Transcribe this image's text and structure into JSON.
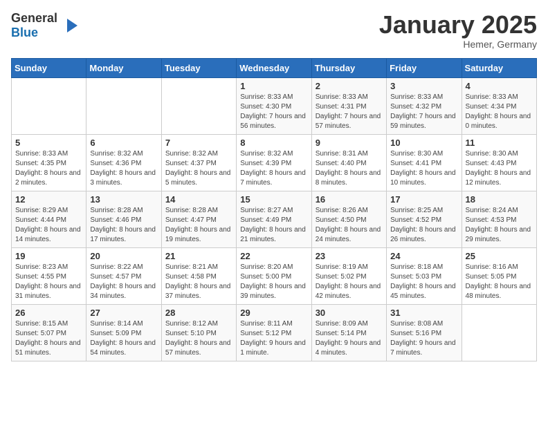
{
  "header": {
    "logo_general": "General",
    "logo_blue": "Blue",
    "title": "January 2025",
    "subtitle": "Hemer, Germany"
  },
  "weekdays": [
    "Sunday",
    "Monday",
    "Tuesday",
    "Wednesday",
    "Thursday",
    "Friday",
    "Saturday"
  ],
  "weeks": [
    [
      {
        "day": "",
        "sunrise": "",
        "sunset": "",
        "daylight": ""
      },
      {
        "day": "",
        "sunrise": "",
        "sunset": "",
        "daylight": ""
      },
      {
        "day": "",
        "sunrise": "",
        "sunset": "",
        "daylight": ""
      },
      {
        "day": "1",
        "sunrise": "Sunrise: 8:33 AM",
        "sunset": "Sunset: 4:30 PM",
        "daylight": "Daylight: 7 hours and 56 minutes."
      },
      {
        "day": "2",
        "sunrise": "Sunrise: 8:33 AM",
        "sunset": "Sunset: 4:31 PM",
        "daylight": "Daylight: 7 hours and 57 minutes."
      },
      {
        "day": "3",
        "sunrise": "Sunrise: 8:33 AM",
        "sunset": "Sunset: 4:32 PM",
        "daylight": "Daylight: 7 hours and 59 minutes."
      },
      {
        "day": "4",
        "sunrise": "Sunrise: 8:33 AM",
        "sunset": "Sunset: 4:34 PM",
        "daylight": "Daylight: 8 hours and 0 minutes."
      }
    ],
    [
      {
        "day": "5",
        "sunrise": "Sunrise: 8:33 AM",
        "sunset": "Sunset: 4:35 PM",
        "daylight": "Daylight: 8 hours and 2 minutes."
      },
      {
        "day": "6",
        "sunrise": "Sunrise: 8:32 AM",
        "sunset": "Sunset: 4:36 PM",
        "daylight": "Daylight: 8 hours and 3 minutes."
      },
      {
        "day": "7",
        "sunrise": "Sunrise: 8:32 AM",
        "sunset": "Sunset: 4:37 PM",
        "daylight": "Daylight: 8 hours and 5 minutes."
      },
      {
        "day": "8",
        "sunrise": "Sunrise: 8:32 AM",
        "sunset": "Sunset: 4:39 PM",
        "daylight": "Daylight: 8 hours and 7 minutes."
      },
      {
        "day": "9",
        "sunrise": "Sunrise: 8:31 AM",
        "sunset": "Sunset: 4:40 PM",
        "daylight": "Daylight: 8 hours and 8 minutes."
      },
      {
        "day": "10",
        "sunrise": "Sunrise: 8:30 AM",
        "sunset": "Sunset: 4:41 PM",
        "daylight": "Daylight: 8 hours and 10 minutes."
      },
      {
        "day": "11",
        "sunrise": "Sunrise: 8:30 AM",
        "sunset": "Sunset: 4:43 PM",
        "daylight": "Daylight: 8 hours and 12 minutes."
      }
    ],
    [
      {
        "day": "12",
        "sunrise": "Sunrise: 8:29 AM",
        "sunset": "Sunset: 4:44 PM",
        "daylight": "Daylight: 8 hours and 14 minutes."
      },
      {
        "day": "13",
        "sunrise": "Sunrise: 8:28 AM",
        "sunset": "Sunset: 4:46 PM",
        "daylight": "Daylight: 8 hours and 17 minutes."
      },
      {
        "day": "14",
        "sunrise": "Sunrise: 8:28 AM",
        "sunset": "Sunset: 4:47 PM",
        "daylight": "Daylight: 8 hours and 19 minutes."
      },
      {
        "day": "15",
        "sunrise": "Sunrise: 8:27 AM",
        "sunset": "Sunset: 4:49 PM",
        "daylight": "Daylight: 8 hours and 21 minutes."
      },
      {
        "day": "16",
        "sunrise": "Sunrise: 8:26 AM",
        "sunset": "Sunset: 4:50 PM",
        "daylight": "Daylight: 8 hours and 24 minutes."
      },
      {
        "day": "17",
        "sunrise": "Sunrise: 8:25 AM",
        "sunset": "Sunset: 4:52 PM",
        "daylight": "Daylight: 8 hours and 26 minutes."
      },
      {
        "day": "18",
        "sunrise": "Sunrise: 8:24 AM",
        "sunset": "Sunset: 4:53 PM",
        "daylight": "Daylight: 8 hours and 29 minutes."
      }
    ],
    [
      {
        "day": "19",
        "sunrise": "Sunrise: 8:23 AM",
        "sunset": "Sunset: 4:55 PM",
        "daylight": "Daylight: 8 hours and 31 minutes."
      },
      {
        "day": "20",
        "sunrise": "Sunrise: 8:22 AM",
        "sunset": "Sunset: 4:57 PM",
        "daylight": "Daylight: 8 hours and 34 minutes."
      },
      {
        "day": "21",
        "sunrise": "Sunrise: 8:21 AM",
        "sunset": "Sunset: 4:58 PM",
        "daylight": "Daylight: 8 hours and 37 minutes."
      },
      {
        "day": "22",
        "sunrise": "Sunrise: 8:20 AM",
        "sunset": "Sunset: 5:00 PM",
        "daylight": "Daylight: 8 hours and 39 minutes."
      },
      {
        "day": "23",
        "sunrise": "Sunrise: 8:19 AM",
        "sunset": "Sunset: 5:02 PM",
        "daylight": "Daylight: 8 hours and 42 minutes."
      },
      {
        "day": "24",
        "sunrise": "Sunrise: 8:18 AM",
        "sunset": "Sunset: 5:03 PM",
        "daylight": "Daylight: 8 hours and 45 minutes."
      },
      {
        "day": "25",
        "sunrise": "Sunrise: 8:16 AM",
        "sunset": "Sunset: 5:05 PM",
        "daylight": "Daylight: 8 hours and 48 minutes."
      }
    ],
    [
      {
        "day": "26",
        "sunrise": "Sunrise: 8:15 AM",
        "sunset": "Sunset: 5:07 PM",
        "daylight": "Daylight: 8 hours and 51 minutes."
      },
      {
        "day": "27",
        "sunrise": "Sunrise: 8:14 AM",
        "sunset": "Sunset: 5:09 PM",
        "daylight": "Daylight: 8 hours and 54 minutes."
      },
      {
        "day": "28",
        "sunrise": "Sunrise: 8:12 AM",
        "sunset": "Sunset: 5:10 PM",
        "daylight": "Daylight: 8 hours and 57 minutes."
      },
      {
        "day": "29",
        "sunrise": "Sunrise: 8:11 AM",
        "sunset": "Sunset: 5:12 PM",
        "daylight": "Daylight: 9 hours and 1 minute."
      },
      {
        "day": "30",
        "sunrise": "Sunrise: 8:09 AM",
        "sunset": "Sunset: 5:14 PM",
        "daylight": "Daylight: 9 hours and 4 minutes."
      },
      {
        "day": "31",
        "sunrise": "Sunrise: 8:08 AM",
        "sunset": "Sunset: 5:16 PM",
        "daylight": "Daylight: 9 hours and 7 minutes."
      },
      {
        "day": "",
        "sunrise": "",
        "sunset": "",
        "daylight": ""
      }
    ]
  ]
}
